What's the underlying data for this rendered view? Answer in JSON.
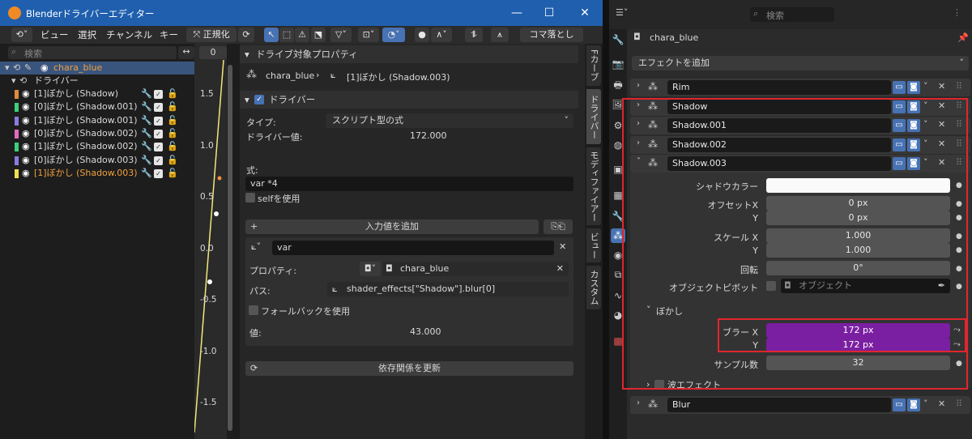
{
  "window": {
    "title": "Blenderドライバーエディター"
  },
  "menu": {
    "view": "ビュー",
    "select": "選択",
    "channel": "チャンネル",
    "key": "キー",
    "normalize": "正規化",
    "frame_drop": "コマ落とし"
  },
  "channels": {
    "search_placeholder": "検索",
    "object": "chara_blue",
    "drivers_label": "ドライバー",
    "items": [
      {
        "label": "[1]ぼかし (Shadow)",
        "color": "#e08a3c"
      },
      {
        "label": "[0]ぼかし (Shadow.001)",
        "color": "#3cd07a"
      },
      {
        "label": "[1]ぼかし (Shadow.001)",
        "color": "#8a7ce0"
      },
      {
        "label": "[0]ぼかし (Shadow.002)",
        "color": "#e06cc0"
      },
      {
        "label": "[1]ぼかし (Shadow.002)",
        "color": "#3cd07a"
      },
      {
        "label": "[0]ぼかし (Shadow.003)",
        "color": "#8a7ce0"
      },
      {
        "label": "[1]ぼかし (Shadow.003)",
        "color": "#f0e050"
      }
    ]
  },
  "graph": {
    "frame": "0",
    "ticks": [
      "1.5",
      "1.0",
      "0.5",
      "0.0",
      "-0.5",
      "-1.0",
      "-1.5"
    ]
  },
  "driver_panel": {
    "target_header": "ドライブ対象プロパティ",
    "target_object": "chara_blue",
    "target_prop": "[1]ぼかし (Shadow.003)",
    "driver_header": "ドライバー",
    "type_label": "タイプ:",
    "type_value": "スクリプト型の式",
    "driver_value_label": "ドライバー値:",
    "driver_value": "172.000",
    "expr_label": "式:",
    "expr_value": "var *4",
    "use_self": "selfを使用",
    "add_input": "入力値を追加",
    "var_name": "var",
    "prop_label": "プロパティ:",
    "prop_object": "chara_blue",
    "path_label": "パス:",
    "path_value": "shader_effects[\"Shadow\"].blur[0]",
    "fallback": "フォールバックを使用",
    "value_label": "値:",
    "value": "43.000",
    "update_deps": "依存関係を更新"
  },
  "tabs": [
    "Fカーブ",
    "ドライバー",
    "モディファイアー",
    "ビュー",
    "カスタム"
  ],
  "properties": {
    "search_placeholder": "検索",
    "object": "chara_blue",
    "add_effect": "エフェクトを追加",
    "modifiers": [
      "Rim",
      "Shadow",
      "Shadow.001",
      "Shadow.002",
      "Shadow.003"
    ],
    "shadow_color_label": "シャドウカラー",
    "offset_label": "オフセットX",
    "offset_x": "0 px",
    "y_label": "Y",
    "offset_y": "0 px",
    "scale_label": "スケール X",
    "scale_x": "1.000",
    "scale_y": "1.000",
    "rotation_label": "回転",
    "rotation": "0°",
    "pivot_label": "オブジェクトピボット",
    "pivot_placeholder": "オブジェクト",
    "blur_section": "ぼかし",
    "blur_x_label": "ブラー X",
    "blur_x": "172 px",
    "blur_y": "172 px",
    "samples_label": "サンプル数",
    "samples": "32",
    "wave_label": "波エフェクト",
    "blur_modifier": "Blur"
  }
}
